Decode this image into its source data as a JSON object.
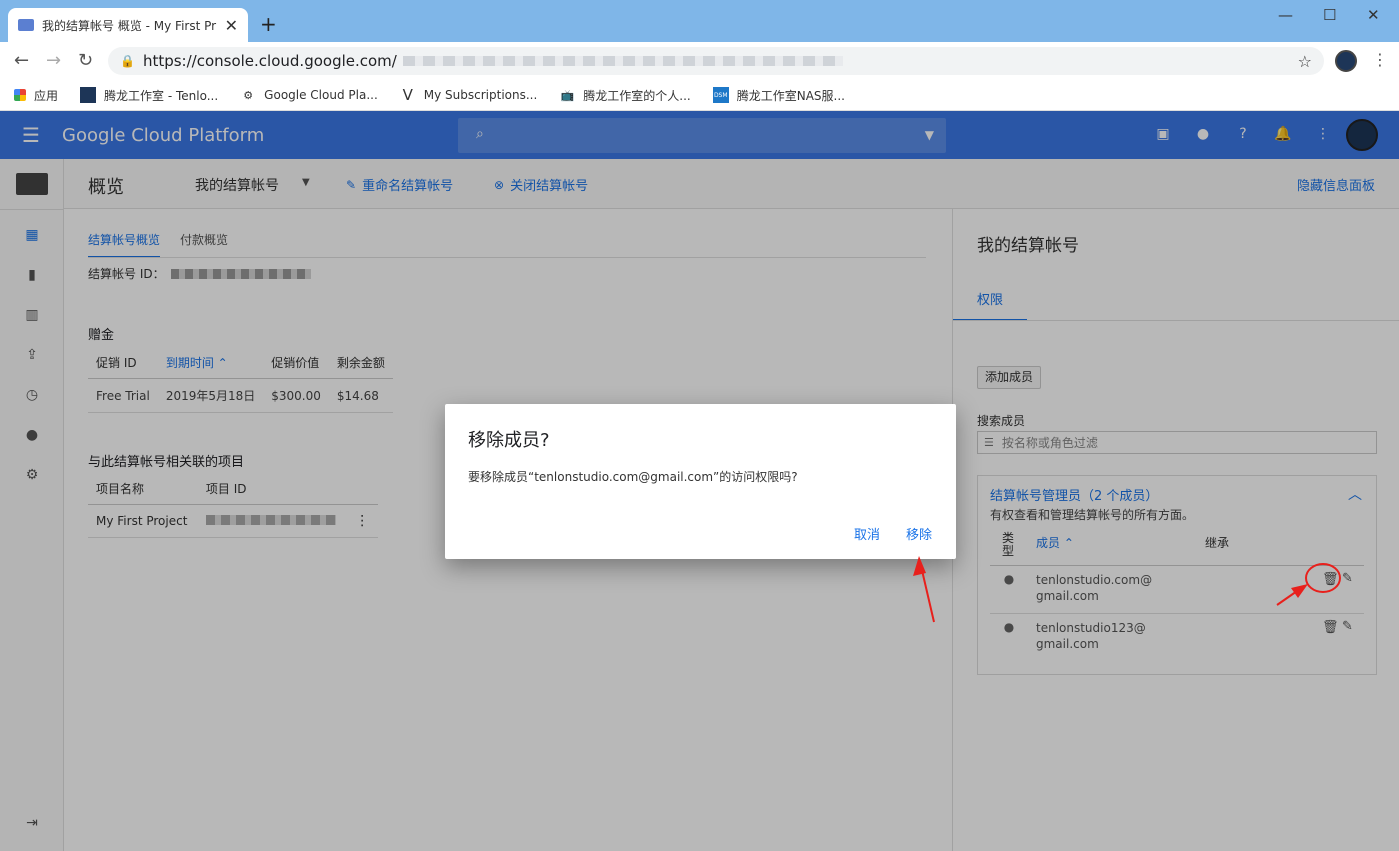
{
  "browser": {
    "tab_title": "我的结算帐号 概览 - My First Pr",
    "url": "https://console.cloud.google.com/",
    "bookmarks": [
      {
        "label": "应用",
        "icon": "apps-grid-icon"
      },
      {
        "label": "腾龙工作室 - Tenlo...",
        "icon": "site-logo-icon"
      },
      {
        "label": "Google Cloud Pla...",
        "icon": "gear-icon"
      },
      {
        "label": "My Subscriptions...",
        "icon": "v-logo-icon"
      },
      {
        "label": "腾龙工作室的个人...",
        "icon": "bilibili-icon"
      },
      {
        "label": "腾龙工作室NAS服...",
        "icon": "dsm-icon"
      }
    ]
  },
  "header": {
    "brand": "Google Cloud Platform"
  },
  "subheader": {
    "title": "概览",
    "account": "我的结算帐号",
    "rename": "重命名结算帐号",
    "close": "关闭结算帐号",
    "hide_panel": "隐藏信息面板"
  },
  "main": {
    "tabs": [
      "结算帐号概览",
      "付款概览"
    ],
    "account_id_label": "结算帐号 ID：",
    "credits_title": "赠金",
    "credits_headers": [
      "促销 ID",
      "到期时间",
      "促销价值",
      "剩余金额"
    ],
    "credits_rows": [
      [
        "Free Trial",
        "2019年5月18日",
        "$300.00",
        "$14.68"
      ]
    ],
    "projects_title": "与此结算帐号相关联的项目",
    "projects_headers": [
      "项目名称",
      "项目 ID"
    ],
    "projects_rows": [
      [
        "My First Project"
      ]
    ]
  },
  "right_panel": {
    "title": "我的结算帐号",
    "tab": "权限",
    "add_member": "添加成员",
    "search_label": "搜索成员",
    "search_placeholder": "按名称或角色过滤",
    "role_title": "结算帐号管理员（2 个成员）",
    "role_desc": "有权查看和管理结算帐号的所有方面。",
    "col_type": "类型",
    "col_member": "成员",
    "col_inherit": "继承",
    "members": [
      {
        "line1": "tenlonstudio.com@",
        "line2": "gmail.com"
      },
      {
        "line1": "tenlonstudio123@",
        "line2": "gmail.com"
      }
    ]
  },
  "dialog": {
    "title": "移除成员?",
    "body": "要移除成员“tenlonstudio.com@gmail.com”的访问权限吗?",
    "cancel": "取消",
    "remove": "移除"
  },
  "colors": {
    "accent": "#1a73e8",
    "header": "#3b78e7",
    "annotation": "#e8201c"
  }
}
